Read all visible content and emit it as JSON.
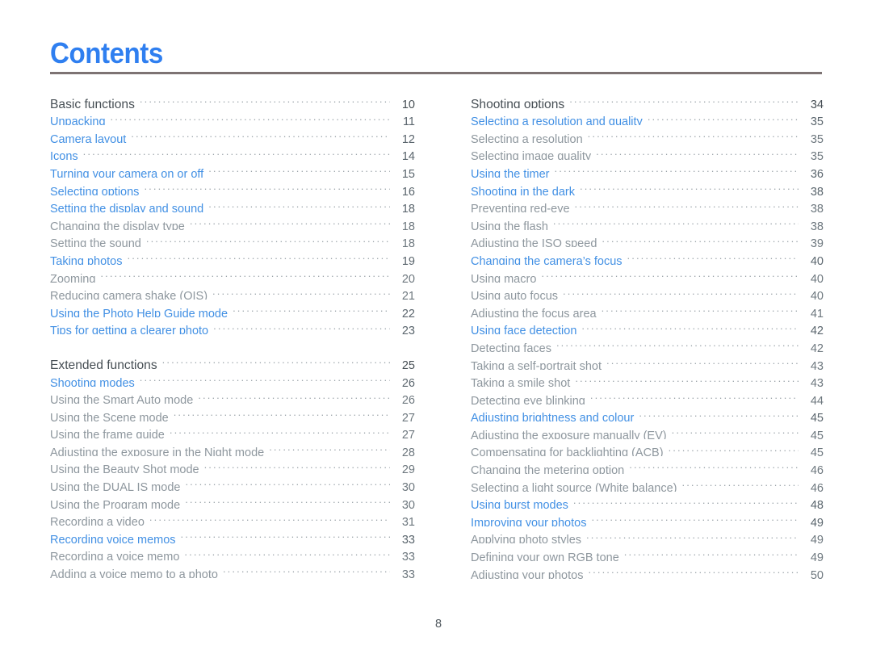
{
  "document": {
    "title": "Contents",
    "page_number": "8",
    "accent_color": "#2f7ff0",
    "link_color": "#4290e4",
    "section_color": "#474f55",
    "sub_color": "#8e979e",
    "rule_color": "#7d7373"
  },
  "left_column": [
    {
      "label": "Basic functions",
      "page": "10",
      "level": "section",
      "gap": false
    },
    {
      "label": "Unpacking",
      "page": "11",
      "level": "link",
      "gap": false
    },
    {
      "label": "Camera layout",
      "page": "12",
      "level": "link",
      "gap": false
    },
    {
      "label": "Icons",
      "page": "14",
      "level": "link",
      "gap": false
    },
    {
      "label": "Turning your camera on or off",
      "page": "15",
      "level": "link",
      "gap": false
    },
    {
      "label": "Selecting options",
      "page": "16",
      "level": "link",
      "gap": false
    },
    {
      "label": "Setting the display and sound",
      "page": "18",
      "level": "link",
      "gap": false
    },
    {
      "label": "Changing the display type",
      "page": "18",
      "level": "sub",
      "gap": false
    },
    {
      "label": "Setting the sound",
      "page": "18",
      "level": "sub",
      "gap": false
    },
    {
      "label": "Taking photos",
      "page": "19",
      "level": "link",
      "gap": false
    },
    {
      "label": "Zooming",
      "page": "20",
      "level": "sub",
      "gap": false
    },
    {
      "label": "Reducing camera shake (OIS)",
      "page": "21",
      "level": "sub",
      "gap": false
    },
    {
      "label": "Using the Photo Help Guide mode",
      "page": "22",
      "level": "link",
      "gap": false
    },
    {
      "label": "Tips for getting a clearer photo",
      "page": "23",
      "level": "link",
      "gap": false
    },
    {
      "label": "Extended functions",
      "page": "25",
      "level": "section",
      "gap": true
    },
    {
      "label": "Shooting modes",
      "page": "26",
      "level": "link",
      "gap": false
    },
    {
      "label": "Using the Smart Auto mode",
      "page": "26",
      "level": "sub",
      "gap": false
    },
    {
      "label": "Using the Scene mode",
      "page": "27",
      "level": "sub",
      "gap": false
    },
    {
      "label": "Using the frame guide",
      "page": "27",
      "level": "sub",
      "gap": false
    },
    {
      "label": "Adjusting the exposure in the Night mode",
      "page": "28",
      "level": "sub",
      "gap": false
    },
    {
      "label": "Using the Beauty Shot mode",
      "page": "29",
      "level": "sub",
      "gap": false
    },
    {
      "label": "Using the DUAL IS mode",
      "page": "30",
      "level": "sub",
      "gap": false
    },
    {
      "label": "Using the Program mode",
      "page": "30",
      "level": "sub",
      "gap": false
    },
    {
      "label": "Recording a video",
      "page": "31",
      "level": "sub",
      "gap": false
    },
    {
      "label": "Recording voice memos",
      "page": "33",
      "level": "link",
      "gap": false
    },
    {
      "label": "Recording a voice memo",
      "page": "33",
      "level": "sub",
      "gap": false
    },
    {
      "label": "Adding a voice memo to a photo",
      "page": "33",
      "level": "sub",
      "gap": false
    }
  ],
  "right_column": [
    {
      "label": "Shooting options",
      "page": "34",
      "level": "section",
      "gap": false
    },
    {
      "label": "Selecting a resolution and quality",
      "page": "35",
      "level": "link",
      "gap": false
    },
    {
      "label": "Selecting a resolution",
      "page": "35",
      "level": "sub",
      "gap": false
    },
    {
      "label": "Selecting image quality",
      "page": "35",
      "level": "sub",
      "gap": false
    },
    {
      "label": "Using the timer",
      "page": "36",
      "level": "link",
      "gap": false
    },
    {
      "label": "Shooting in the dark",
      "page": "38",
      "level": "link",
      "gap": false
    },
    {
      "label": "Preventing red-eye",
      "page": "38",
      "level": "sub",
      "gap": false
    },
    {
      "label": "Using the flash",
      "page": "38",
      "level": "sub",
      "gap": false
    },
    {
      "label": "Adjusting the ISO speed",
      "page": "39",
      "level": "sub",
      "gap": false
    },
    {
      "label": "Changing the camera’s focus",
      "page": "40",
      "level": "link",
      "gap": false
    },
    {
      "label": "Using macro",
      "page": "40",
      "level": "sub",
      "gap": false
    },
    {
      "label": "Using auto focus",
      "page": "40",
      "level": "sub",
      "gap": false
    },
    {
      "label": "Adjusting the focus area",
      "page": "41",
      "level": "sub",
      "gap": false
    },
    {
      "label": "Using face detection",
      "page": "42",
      "level": "link",
      "gap": false
    },
    {
      "label": "Detecting faces",
      "page": "42",
      "level": "sub",
      "gap": false
    },
    {
      "label": "Taking a self-portrait shot",
      "page": "43",
      "level": "sub",
      "gap": false
    },
    {
      "label": "Taking a smile shot",
      "page": "43",
      "level": "sub",
      "gap": false
    },
    {
      "label": "Detecting eye blinking",
      "page": "44",
      "level": "sub",
      "gap": false
    },
    {
      "label": "Adjusting brightness and colour",
      "page": "45",
      "level": "link",
      "gap": false
    },
    {
      "label": "Adjusting the exposure manually (EV)",
      "page": "45",
      "level": "sub",
      "gap": false
    },
    {
      "label": "Compensating for backlighting (ACB)",
      "page": "45",
      "level": "sub",
      "gap": false
    },
    {
      "label": "Changing the metering option",
      "page": "46",
      "level": "sub",
      "gap": false
    },
    {
      "label": "Selecting a light source (White balance)",
      "page": "46",
      "level": "sub",
      "gap": false
    },
    {
      "label": "Using burst modes",
      "page": "48",
      "level": "link",
      "gap": false
    },
    {
      "label": "Improving your photos",
      "page": "49",
      "level": "link",
      "gap": false
    },
    {
      "label": "Applying photo styles",
      "page": "49",
      "level": "sub",
      "gap": false
    },
    {
      "label": "Defining your own RGB tone",
      "page": "49",
      "level": "sub",
      "gap": false
    },
    {
      "label": "Adjusting your photos",
      "page": "50",
      "level": "sub",
      "gap": false
    }
  ]
}
